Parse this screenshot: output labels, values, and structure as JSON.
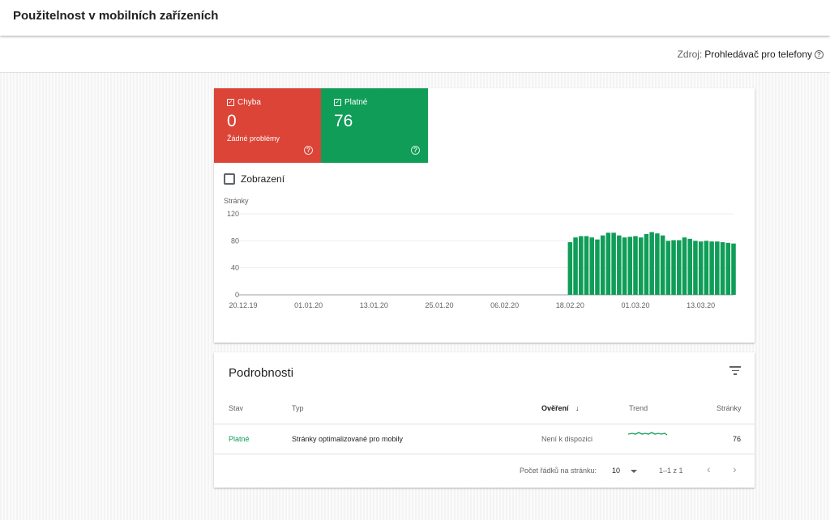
{
  "page": {
    "title": "Použitelnost v mobilních zařízeních"
  },
  "source": {
    "label": "Zdroj:",
    "value": "Prohledávač pro telefony",
    "icon": "help-icon"
  },
  "tiles": {
    "error": {
      "label": "Chyba",
      "value": "0",
      "subtitle": "Žádné problémy",
      "color": "#db4437"
    },
    "valid": {
      "label": "Platné",
      "value": "76",
      "color": "#0f9d58"
    }
  },
  "impressions": {
    "label": "Zobrazení",
    "checked": false
  },
  "chart_data": {
    "type": "bar",
    "ylabel": "Stránky",
    "ylim": [
      0,
      120
    ],
    "yticks": [
      "0",
      "40",
      "80",
      "120"
    ],
    "xticks": [
      "20.12.19",
      "01.01.20",
      "13.01.20",
      "25.01.20",
      "06.02.20",
      "18.02.20",
      "01.03.20",
      "13.03.20"
    ],
    "first_date": "2019-12-20",
    "last_date": "2020-03-19",
    "series": [
      {
        "color": "#0f9d58",
        "values": [
          78,
          85,
          87,
          87,
          85,
          82,
          88,
          92,
          92,
          88,
          85,
          86,
          87,
          85,
          90,
          93,
          91,
          88,
          80,
          81,
          81,
          85,
          83,
          80,
          79,
          80,
          79,
          79,
          78,
          77,
          76
        ]
      }
    ],
    "series_start_date": "2020-02-18",
    "grid": true
  },
  "details": {
    "title": "Podrobnosti",
    "columns": {
      "status": "Stav",
      "type": "Typ",
      "validation": "Ověření",
      "trend": "Trend",
      "pages": "Stránky"
    },
    "rows": [
      {
        "status": "Platné",
        "type": "Stránky optimalizované pro mobily",
        "validation": "Není k dispozici",
        "pages": "76"
      }
    ],
    "rows_per_page_label": "Počet řádků na stránku:",
    "rows_per_page": "10",
    "range": "1–1 z 1"
  }
}
